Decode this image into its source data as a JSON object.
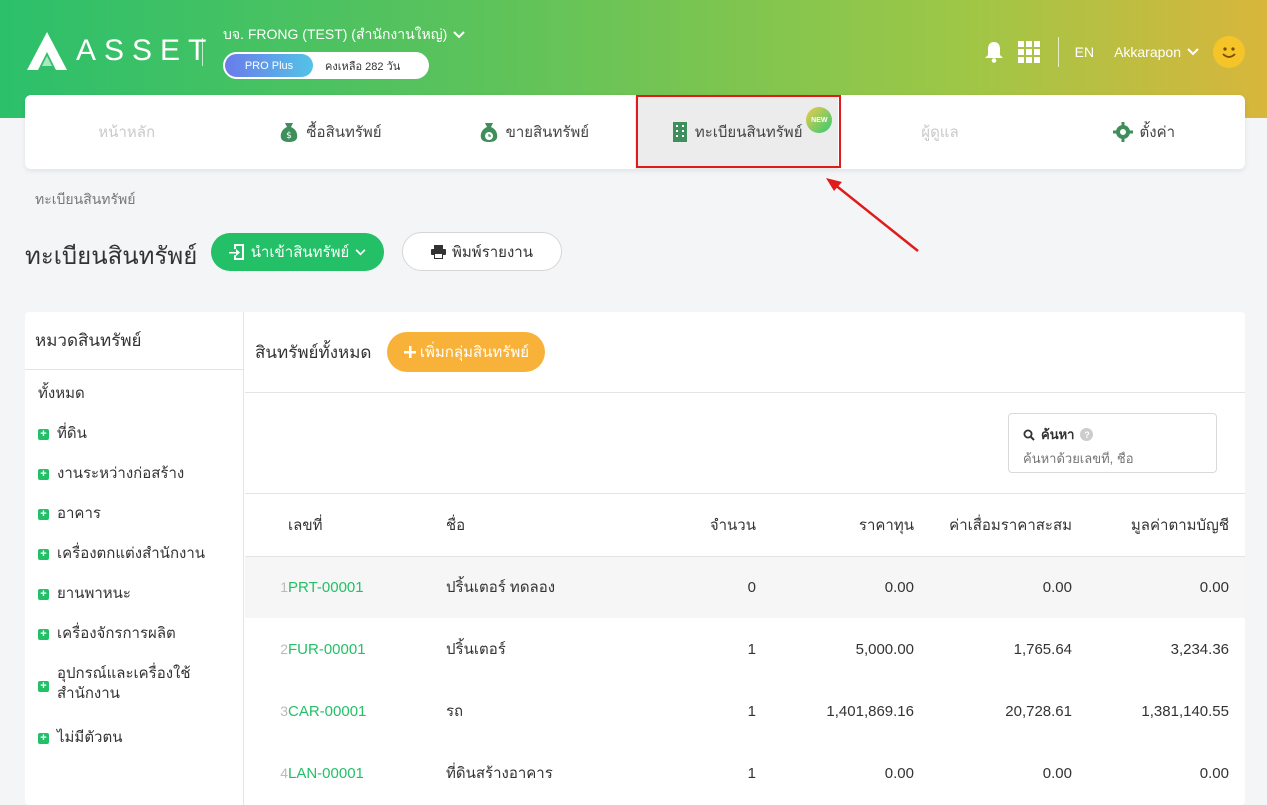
{
  "brand": {
    "logo_text": "ASSET"
  },
  "company": {
    "name": "บจ. FRONG (TEST) (สำนักงานใหญ่)",
    "plan_label": "PRO Plus",
    "remaining": "คงเหลือ 282 วัน"
  },
  "top_right": {
    "language": "EN",
    "user_name": "Akkarapon"
  },
  "nav": {
    "items": [
      {
        "label": "หน้าหลัก"
      },
      {
        "label": "ซื้อสินทรัพย์"
      },
      {
        "label": "ขายสินทรัพย์"
      },
      {
        "label": "ทะเบียนสินทรัพย์",
        "badge": "NEW"
      },
      {
        "label": "ผู้ดูแล"
      },
      {
        "label": "ตั้งค่า"
      }
    ]
  },
  "breadcrumb": "ทะเบียนสินทรัพย์",
  "page": {
    "title": "ทะเบียนสินทรัพย์",
    "import_label": "นำเข้าสินทรัพย์",
    "print_label": "พิมพ์รายงาน"
  },
  "sidebar": {
    "title": "หมวดสินทรัพย์",
    "all_label": "ทั้งหมด",
    "items": [
      {
        "label": "ที่ดิน"
      },
      {
        "label": "งานระหว่างก่อสร้าง"
      },
      {
        "label": "อาคาร"
      },
      {
        "label": "เครื่องตกแต่งสำนักงาน"
      },
      {
        "label": "ยานพาหนะ"
      },
      {
        "label": "เครื่องจักรการผลิต"
      },
      {
        "label": "อุปกรณ์และเครื่องใช้สำนักงาน"
      },
      {
        "label": "ไม่มีตัวตน"
      }
    ]
  },
  "content": {
    "title": "สินทรัพย์ทั้งหมด",
    "add_group_label": "เพิ่มกลุ่มสินทรัพย์",
    "search": {
      "label": "ค้นหา",
      "placeholder": "ค้นหาด้วยเลขที่, ชื่อ"
    }
  },
  "table": {
    "headers": {
      "code": "เลขที่",
      "name": "ชื่อ",
      "qty": "จำนวน",
      "cost": "ราคาทุน",
      "depreciation": "ค่าเสื่อมราคาสะสม",
      "book_value": "มูลค่าตามบัญชี"
    },
    "rows": [
      {
        "idx": "1",
        "code": "PRT-00001",
        "name": "ปริ้นเตอร์ ทดลอง",
        "qty": "0",
        "cost": "0.00",
        "depreciation": "0.00",
        "book_value": "0.00"
      },
      {
        "idx": "2",
        "code": "FUR-00001",
        "name": "ปริ้นเตอร์",
        "qty": "1",
        "cost": "5,000.00",
        "depreciation": "1,765.64",
        "book_value": "3,234.36"
      },
      {
        "idx": "3",
        "code": "CAR-00001",
        "name": "รถ",
        "qty": "1",
        "cost": "1,401,869.16",
        "depreciation": "20,728.61",
        "book_value": "1,381,140.55"
      },
      {
        "idx": "4",
        "code": "LAN-00001",
        "name": "ที่ดินสร้างอาคาร",
        "qty": "1",
        "cost": "0.00",
        "depreciation": "0.00",
        "book_value": "0.00"
      }
    ]
  },
  "colors": {
    "brand_green": "#23c067",
    "accent_orange": "#f8b23a",
    "highlight_red": "#e01b1b"
  }
}
